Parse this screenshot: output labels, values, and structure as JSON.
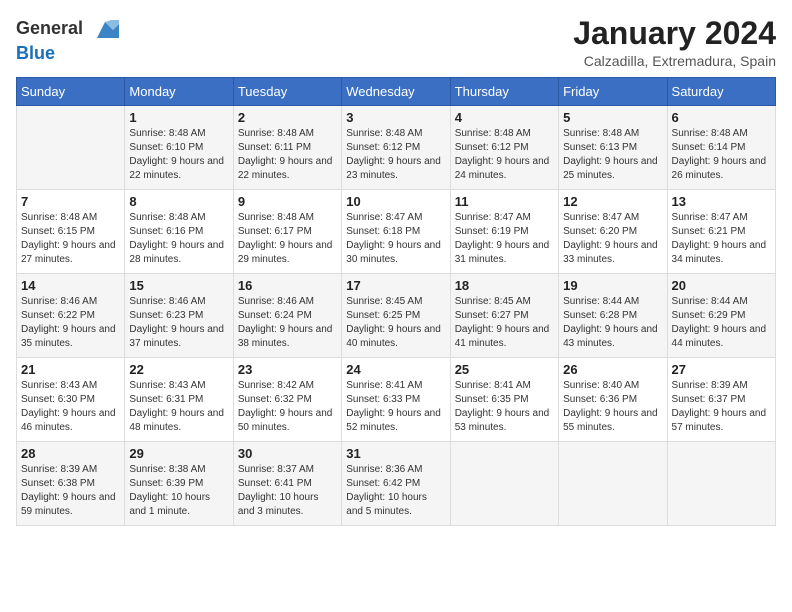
{
  "logo": {
    "general": "General",
    "blue": "Blue"
  },
  "header": {
    "title": "January 2024",
    "subtitle": "Calzadilla, Extremadura, Spain"
  },
  "weekdays": [
    "Sunday",
    "Monday",
    "Tuesday",
    "Wednesday",
    "Thursday",
    "Friday",
    "Saturday"
  ],
  "weeks": [
    [
      {
        "day": "",
        "sunrise": "",
        "sunset": "",
        "daylight": ""
      },
      {
        "day": "1",
        "sunrise": "Sunrise: 8:48 AM",
        "sunset": "Sunset: 6:10 PM",
        "daylight": "Daylight: 9 hours and 22 minutes."
      },
      {
        "day": "2",
        "sunrise": "Sunrise: 8:48 AM",
        "sunset": "Sunset: 6:11 PM",
        "daylight": "Daylight: 9 hours and 22 minutes."
      },
      {
        "day": "3",
        "sunrise": "Sunrise: 8:48 AM",
        "sunset": "Sunset: 6:12 PM",
        "daylight": "Daylight: 9 hours and 23 minutes."
      },
      {
        "day": "4",
        "sunrise": "Sunrise: 8:48 AM",
        "sunset": "Sunset: 6:12 PM",
        "daylight": "Daylight: 9 hours and 24 minutes."
      },
      {
        "day": "5",
        "sunrise": "Sunrise: 8:48 AM",
        "sunset": "Sunset: 6:13 PM",
        "daylight": "Daylight: 9 hours and 25 minutes."
      },
      {
        "day": "6",
        "sunrise": "Sunrise: 8:48 AM",
        "sunset": "Sunset: 6:14 PM",
        "daylight": "Daylight: 9 hours and 26 minutes."
      }
    ],
    [
      {
        "day": "7",
        "sunrise": "Sunrise: 8:48 AM",
        "sunset": "Sunset: 6:15 PM",
        "daylight": "Daylight: 9 hours and 27 minutes."
      },
      {
        "day": "8",
        "sunrise": "Sunrise: 8:48 AM",
        "sunset": "Sunset: 6:16 PM",
        "daylight": "Daylight: 9 hours and 28 minutes."
      },
      {
        "day": "9",
        "sunrise": "Sunrise: 8:48 AM",
        "sunset": "Sunset: 6:17 PM",
        "daylight": "Daylight: 9 hours and 29 minutes."
      },
      {
        "day": "10",
        "sunrise": "Sunrise: 8:47 AM",
        "sunset": "Sunset: 6:18 PM",
        "daylight": "Daylight: 9 hours and 30 minutes."
      },
      {
        "day": "11",
        "sunrise": "Sunrise: 8:47 AM",
        "sunset": "Sunset: 6:19 PM",
        "daylight": "Daylight: 9 hours and 31 minutes."
      },
      {
        "day": "12",
        "sunrise": "Sunrise: 8:47 AM",
        "sunset": "Sunset: 6:20 PM",
        "daylight": "Daylight: 9 hours and 33 minutes."
      },
      {
        "day": "13",
        "sunrise": "Sunrise: 8:47 AM",
        "sunset": "Sunset: 6:21 PM",
        "daylight": "Daylight: 9 hours and 34 minutes."
      }
    ],
    [
      {
        "day": "14",
        "sunrise": "Sunrise: 8:46 AM",
        "sunset": "Sunset: 6:22 PM",
        "daylight": "Daylight: 9 hours and 35 minutes."
      },
      {
        "day": "15",
        "sunrise": "Sunrise: 8:46 AM",
        "sunset": "Sunset: 6:23 PM",
        "daylight": "Daylight: 9 hours and 37 minutes."
      },
      {
        "day": "16",
        "sunrise": "Sunrise: 8:46 AM",
        "sunset": "Sunset: 6:24 PM",
        "daylight": "Daylight: 9 hours and 38 minutes."
      },
      {
        "day": "17",
        "sunrise": "Sunrise: 8:45 AM",
        "sunset": "Sunset: 6:25 PM",
        "daylight": "Daylight: 9 hours and 40 minutes."
      },
      {
        "day": "18",
        "sunrise": "Sunrise: 8:45 AM",
        "sunset": "Sunset: 6:27 PM",
        "daylight": "Daylight: 9 hours and 41 minutes."
      },
      {
        "day": "19",
        "sunrise": "Sunrise: 8:44 AM",
        "sunset": "Sunset: 6:28 PM",
        "daylight": "Daylight: 9 hours and 43 minutes."
      },
      {
        "day": "20",
        "sunrise": "Sunrise: 8:44 AM",
        "sunset": "Sunset: 6:29 PM",
        "daylight": "Daylight: 9 hours and 44 minutes."
      }
    ],
    [
      {
        "day": "21",
        "sunrise": "Sunrise: 8:43 AM",
        "sunset": "Sunset: 6:30 PM",
        "daylight": "Daylight: 9 hours and 46 minutes."
      },
      {
        "day": "22",
        "sunrise": "Sunrise: 8:43 AM",
        "sunset": "Sunset: 6:31 PM",
        "daylight": "Daylight: 9 hours and 48 minutes."
      },
      {
        "day": "23",
        "sunrise": "Sunrise: 8:42 AM",
        "sunset": "Sunset: 6:32 PM",
        "daylight": "Daylight: 9 hours and 50 minutes."
      },
      {
        "day": "24",
        "sunrise": "Sunrise: 8:41 AM",
        "sunset": "Sunset: 6:33 PM",
        "daylight": "Daylight: 9 hours and 52 minutes."
      },
      {
        "day": "25",
        "sunrise": "Sunrise: 8:41 AM",
        "sunset": "Sunset: 6:35 PM",
        "daylight": "Daylight: 9 hours and 53 minutes."
      },
      {
        "day": "26",
        "sunrise": "Sunrise: 8:40 AM",
        "sunset": "Sunset: 6:36 PM",
        "daylight": "Daylight: 9 hours and 55 minutes."
      },
      {
        "day": "27",
        "sunrise": "Sunrise: 8:39 AM",
        "sunset": "Sunset: 6:37 PM",
        "daylight": "Daylight: 9 hours and 57 minutes."
      }
    ],
    [
      {
        "day": "28",
        "sunrise": "Sunrise: 8:39 AM",
        "sunset": "Sunset: 6:38 PM",
        "daylight": "Daylight: 9 hours and 59 minutes."
      },
      {
        "day": "29",
        "sunrise": "Sunrise: 8:38 AM",
        "sunset": "Sunset: 6:39 PM",
        "daylight": "Daylight: 10 hours and 1 minute."
      },
      {
        "day": "30",
        "sunrise": "Sunrise: 8:37 AM",
        "sunset": "Sunset: 6:41 PM",
        "daylight": "Daylight: 10 hours and 3 minutes."
      },
      {
        "day": "31",
        "sunrise": "Sunrise: 8:36 AM",
        "sunset": "Sunset: 6:42 PM",
        "daylight": "Daylight: 10 hours and 5 minutes."
      },
      {
        "day": "",
        "sunrise": "",
        "sunset": "",
        "daylight": ""
      },
      {
        "day": "",
        "sunrise": "",
        "sunset": "",
        "daylight": ""
      },
      {
        "day": "",
        "sunrise": "",
        "sunset": "",
        "daylight": ""
      }
    ]
  ]
}
